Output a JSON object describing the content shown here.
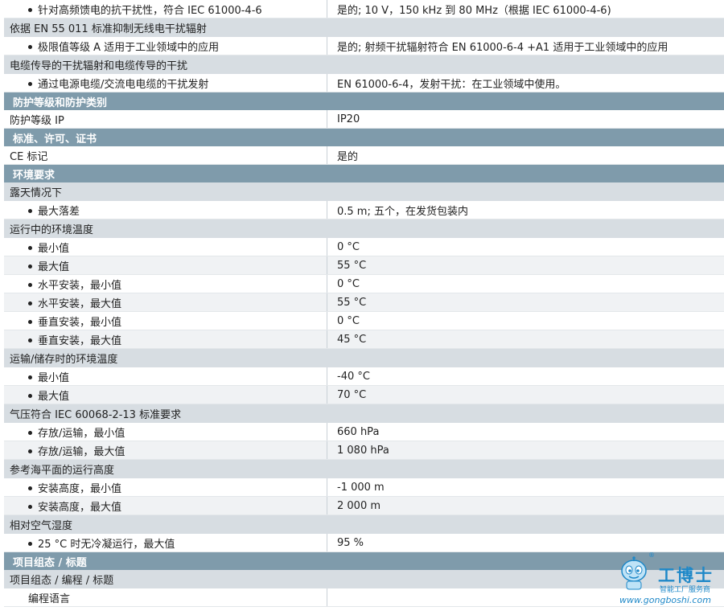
{
  "rows": [
    {
      "type": "item",
      "label": "针对高频馈电的抗干扰性，符合 IEC 61000-4-6",
      "value": "是的; 10 V，150 kHz 到 80 MHz（根据 IEC 61000-4-6)",
      "bullet": true
    },
    {
      "type": "group",
      "label": "依据 EN 55 011 标准抑制无线电干扰辐射"
    },
    {
      "type": "item",
      "label": "极限值等级 A 适用于工业领域中的应用",
      "value": "是的; 射频干扰辐射符合 EN 61000-6-4 +A1 适用于工业领域中的应用",
      "bullet": true
    },
    {
      "type": "group",
      "label": "电缆传导的干扰辐射和电缆传导的干扰"
    },
    {
      "type": "item",
      "label": "通过电源电缆/交流电电缆的干扰发射",
      "value": "EN 61000-6-4，发射干扰：在工业领域中使用。",
      "bullet": true
    },
    {
      "type": "section",
      "label": "防护等级和防护类别"
    },
    {
      "type": "item",
      "label": "防护等级 IP",
      "value": "IP20",
      "bullet": false
    },
    {
      "type": "section",
      "label": "标准、许可、证书"
    },
    {
      "type": "item",
      "label": "CE 标记",
      "value": "是的",
      "bullet": false
    },
    {
      "type": "section",
      "label": "环境要求"
    },
    {
      "type": "group",
      "label": "露天情况下"
    },
    {
      "type": "item",
      "label": "最大落差",
      "value": "0.5 m; 五个，在发货包装内",
      "bullet": true
    },
    {
      "type": "group",
      "label": "运行中的环境温度"
    },
    {
      "type": "item",
      "label": "最小值",
      "value": "0 °C",
      "bullet": true
    },
    {
      "type": "item",
      "label": "最大值",
      "value": "55 °C",
      "bullet": true
    },
    {
      "type": "item",
      "label": "水平安装，最小值",
      "value": "0 °C",
      "bullet": true
    },
    {
      "type": "item",
      "label": "水平安装，最大值",
      "value": "55 °C",
      "bullet": true
    },
    {
      "type": "item",
      "label": "垂直安装，最小值",
      "value": "0 °C",
      "bullet": true
    },
    {
      "type": "item",
      "label": "垂直安装，最大值",
      "value": "45 °C",
      "bullet": true
    },
    {
      "type": "group",
      "label": "运输/储存时的环境温度"
    },
    {
      "type": "item",
      "label": "最小值",
      "value": "-40 °C",
      "bullet": true
    },
    {
      "type": "item",
      "label": "最大值",
      "value": "70 °C",
      "bullet": true
    },
    {
      "type": "group",
      "label": "气压符合 IEC 60068-2-13 标准要求"
    },
    {
      "type": "item",
      "label": "存放/运输，最小值",
      "value": "660 hPa",
      "bullet": true
    },
    {
      "type": "item",
      "label": "存放/运输，最大值",
      "value": "1 080 hPa",
      "bullet": true
    },
    {
      "type": "group",
      "label": "参考海平面的运行高度"
    },
    {
      "type": "item",
      "label": "安装高度，最小值",
      "value": "-1 000 m",
      "bullet": true
    },
    {
      "type": "item",
      "label": "安装高度，最大值",
      "value": "2 000 m",
      "bullet": true
    },
    {
      "type": "group",
      "label": "相对空气湿度"
    },
    {
      "type": "item",
      "label": "25 °C 时无冷凝运行，最大值",
      "value": "95 %",
      "bullet": true
    },
    {
      "type": "section",
      "label": "项目组态 / 标题"
    },
    {
      "type": "group",
      "label": "项目组态 / 编程 / 标题"
    },
    {
      "type": "item",
      "label": "编程语言",
      "value": "",
      "bullet": false
    }
  ],
  "watermark": {
    "brand": "工博士",
    "subtitle": "智能工厂服务商",
    "url": "www.gongboshi.com",
    "registered": "®",
    "color": "#1e88c8"
  }
}
